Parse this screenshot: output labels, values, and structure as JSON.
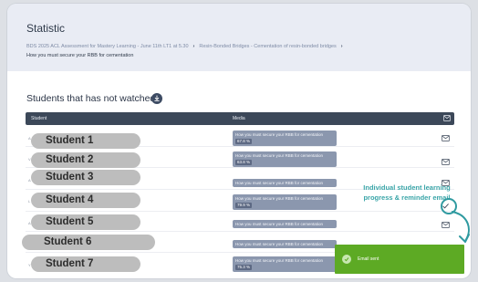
{
  "header": {
    "title": "Statistic",
    "breadcrumb": {
      "course": "BDS 2025 ACL Assessment for Mastery Learning - June 11th LT1 at 5.30",
      "module": "Resin-Bonded Bridges - Cementation of resin-bonded bridges",
      "lesson": "How you must secure your RBB for cementation"
    }
  },
  "section": {
    "title": "Students that has not watched",
    "download_icon": "download-icon"
  },
  "table": {
    "columns": {
      "student": "Student",
      "media": "Media",
      "action_icon": "mail-icon"
    },
    "rows": [
      {
        "stub": "A",
        "student": "Student 1",
        "media": "How you must secure your RBB for cementation",
        "progress": "67.8 %"
      },
      {
        "stub": "V",
        "student": "Student 2",
        "media": "How you must secure your RBB for cementation",
        "progress": "63.8 %"
      },
      {
        "stub": "A",
        "student": "Student 3",
        "media": "How you must secure your RBB for cementation",
        "progress": ""
      },
      {
        "stub": "L",
        "student": "Student 4",
        "media": "How you must secure your RBB for cementation",
        "progress": "79.9 %"
      },
      {
        "stub": "A",
        "student": "Student 5",
        "media": "How you must secure your RBB for cementation",
        "progress": ""
      },
      {
        "stub": "",
        "student": "Student 6",
        "media": "How you must secure your RBB for cementation",
        "progress": ""
      },
      {
        "stub": "Y",
        "student": "Student 7",
        "media": "How you must secure your RBB for cementation",
        "progress": "75.3 %"
      }
    ]
  },
  "annotation": {
    "text": "Individual student learning progress & reminder email"
  },
  "toast": {
    "text": "Email sent",
    "icon": "check-icon"
  },
  "colors": {
    "header_bg": "#e9ecf4",
    "table_head": "#3c4859",
    "media_box": "#8b97ae",
    "accent": "#3aa5a8",
    "toast": "#5daa24"
  }
}
